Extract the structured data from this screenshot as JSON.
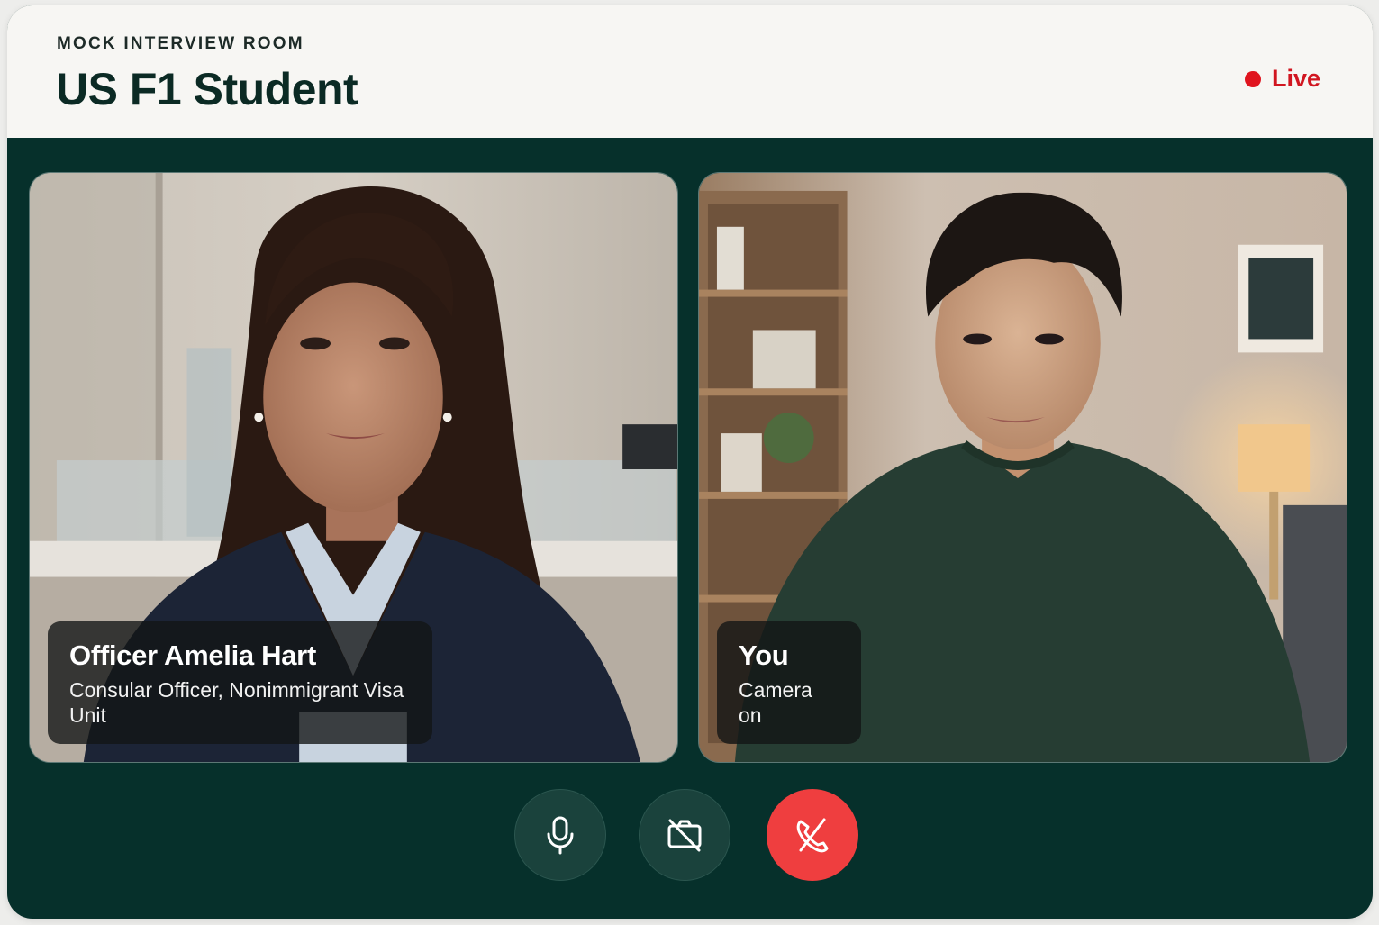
{
  "header": {
    "eyebrow": "MOCK INTERVIEW ROOM",
    "title": "US F1 Student",
    "status_label": "Live",
    "status_color": "#e0141e"
  },
  "participants": [
    {
      "name": "Officer Amelia Hart",
      "subtitle": "Consular Officer, Nonimmigrant Visa Unit"
    },
    {
      "name": "You",
      "subtitle": "Camera on"
    }
  ],
  "controls": [
    {
      "icon": "microphone-icon"
    },
    {
      "icon": "camera-off-icon"
    },
    {
      "icon": "end-call-icon",
      "color": "#ef3e3f"
    }
  ],
  "theme": {
    "background": "#06302b",
    "header_background": "#f7f6f3"
  }
}
